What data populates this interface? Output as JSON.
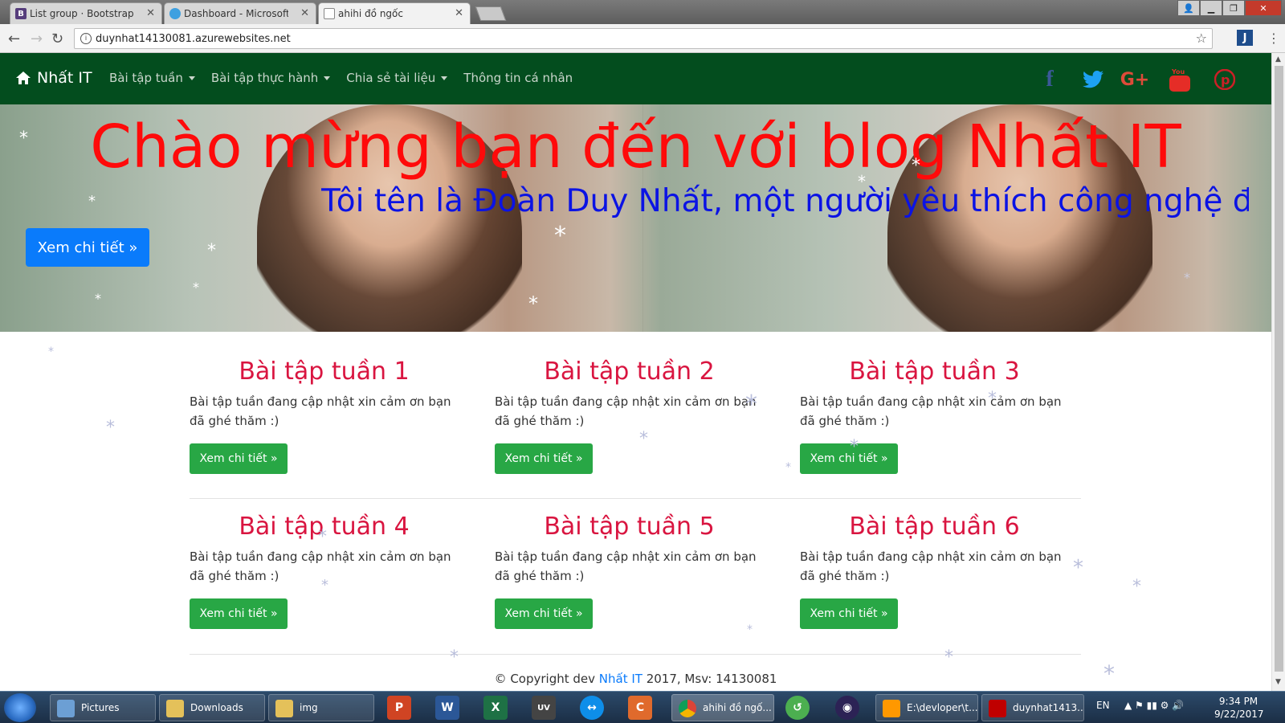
{
  "browser": {
    "tabs": [
      {
        "label": "List group · Bootstrap",
        "icon": "bootstrap-icon"
      },
      {
        "label": "Dashboard - Microsoft A",
        "icon": "azure-cloud-icon"
      },
      {
        "label": "ahihi đồ ngốc",
        "icon": "page-icon"
      }
    ],
    "url": "duynhat14130081.azurewebsites.net"
  },
  "site": {
    "brand": "Nhất IT",
    "nav": [
      {
        "label": "Bài tập tuần"
      },
      {
        "label": "Bài tập thực hành"
      },
      {
        "label": "Chia sẻ tài liệu"
      },
      {
        "label": "Thông tin cá nhân"
      }
    ],
    "social": [
      {
        "name": "facebook-icon",
        "glyph": "f",
        "color": "#3b5998"
      },
      {
        "name": "twitter-icon",
        "glyph": "t",
        "color": "#1da1f2"
      },
      {
        "name": "google-plus-icon",
        "glyph": "G+",
        "color": "#dd4b39"
      },
      {
        "name": "youtube-icon",
        "glyph": "You",
        "color": "#e52d27"
      },
      {
        "name": "pinterest-icon",
        "glyph": "P",
        "color": "#cb2027"
      }
    ]
  },
  "hero": {
    "title": "Chào mừng bạn đến với blog Nhất IT",
    "subtitle": "Tôi tên là Đoàn Duy Nhất, một người yêu thích công nghệ đây l",
    "button": "Xem chi tiết »"
  },
  "cards": [
    {
      "title": "Bài tập tuần 1",
      "text": "Bài tập tuần đang cập nhật xin cảm ơn bạn đã ghé thăm :)",
      "button": "Xem chi tiết »"
    },
    {
      "title": "Bài tập tuần 2",
      "text": "Bài tập tuần đang cập nhật xin cảm ơn bạn đã ghé thăm :)",
      "button": "Xem chi tiết »"
    },
    {
      "title": "Bài tập tuần 3",
      "text": "Bài tập tuần đang cập nhật xin cảm ơn bạn đã ghé thăm :)",
      "button": "Xem chi tiết »"
    },
    {
      "title": "Bài tập tuần 4",
      "text": "Bài tập tuần đang cập nhật xin cảm ơn bạn đã ghé thăm :)",
      "button": "Xem chi tiết »"
    },
    {
      "title": "Bài tập tuần 5",
      "text": "Bài tập tuần đang cập nhật xin cảm ơn bạn đã ghé thăm :)",
      "button": "Xem chi tiết »"
    },
    {
      "title": "Bài tập tuần 6",
      "text": "Bài tập tuần đang cập nhật xin cảm ơn bạn đã ghé thăm :)",
      "button": "Xem chi tiết »"
    }
  ],
  "footer": {
    "prefix": "© Copyright dev ",
    "link": "Nhất IT",
    "suffix": " 2017, Msv: 14130081"
  },
  "taskbar": {
    "items": [
      {
        "label": "Pictures"
      },
      {
        "label": "Downloads"
      },
      {
        "label": "img"
      },
      {
        "label": "ahihi đồ ngố..."
      },
      {
        "label": "E:\\devloper\\t..."
      },
      {
        "label": "duynhat1413..."
      }
    ],
    "lang": "EN",
    "time": "9:34 PM",
    "date": "9/22/2017"
  }
}
